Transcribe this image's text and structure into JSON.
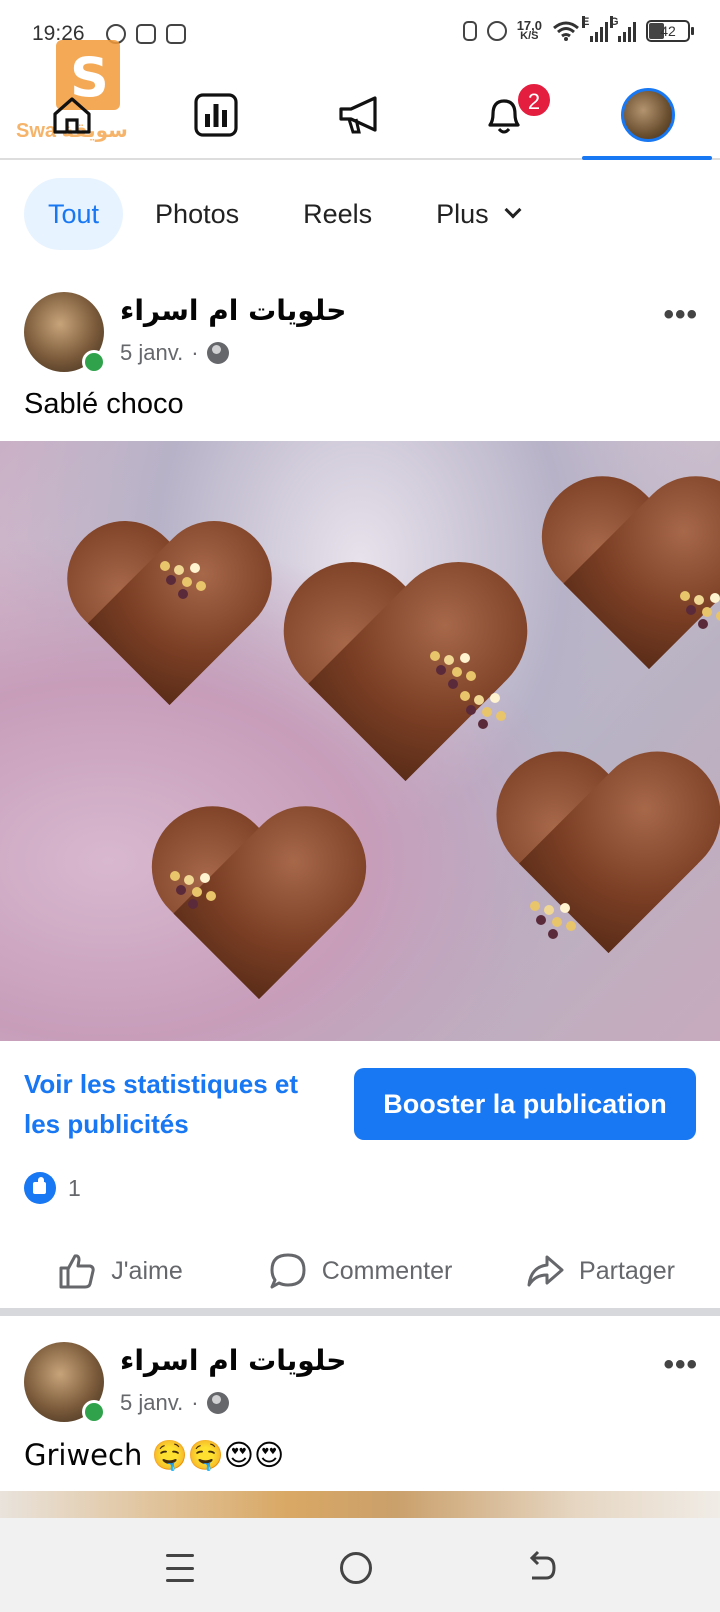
{
  "status_bar": {
    "time": "19:26",
    "net_speed_value": "17,0",
    "net_speed_unit": "K/S",
    "signal1_label": "E",
    "signal2_label": "G",
    "battery": "42"
  },
  "watermark": {
    "text": "Swa سويقة"
  },
  "top_nav": {
    "notifications_badge": "2",
    "active_tab": "profile"
  },
  "filters": {
    "chips": [
      "Tout",
      "Photos",
      "Reels",
      "Plus"
    ],
    "active": "Tout"
  },
  "posts": [
    {
      "author": "حلويات ام اسراء",
      "date": "5 janv.",
      "separator": "·",
      "text": "Sablé choco",
      "image_subject": "chocolate heart sablés with sprinkles"
    },
    {
      "author": "حلويات ام اسراء",
      "date": "5 janv.",
      "separator": "·",
      "text": "Griwech 🤤🤤😍😍"
    }
  ],
  "post_actions": {
    "stats_link": "Voir les statistiques et les publicités",
    "boost_button": "Booster la publication",
    "reaction_count": "1",
    "like": "J'aime",
    "comment": "Commenter",
    "share": "Partager"
  },
  "colors": {
    "accent": "#1877f2",
    "badge": "#e41e3f",
    "online": "#31a24c",
    "chip_active_bg": "#e7f3ff"
  },
  "icons": [
    "home-icon",
    "stats-icon",
    "megaphone-icon",
    "bell-icon",
    "profile-avatar",
    "globe-icon",
    "more-icon",
    "like-icon",
    "comment-icon",
    "share-icon",
    "recents-icon",
    "home-button-icon",
    "back-icon"
  ]
}
